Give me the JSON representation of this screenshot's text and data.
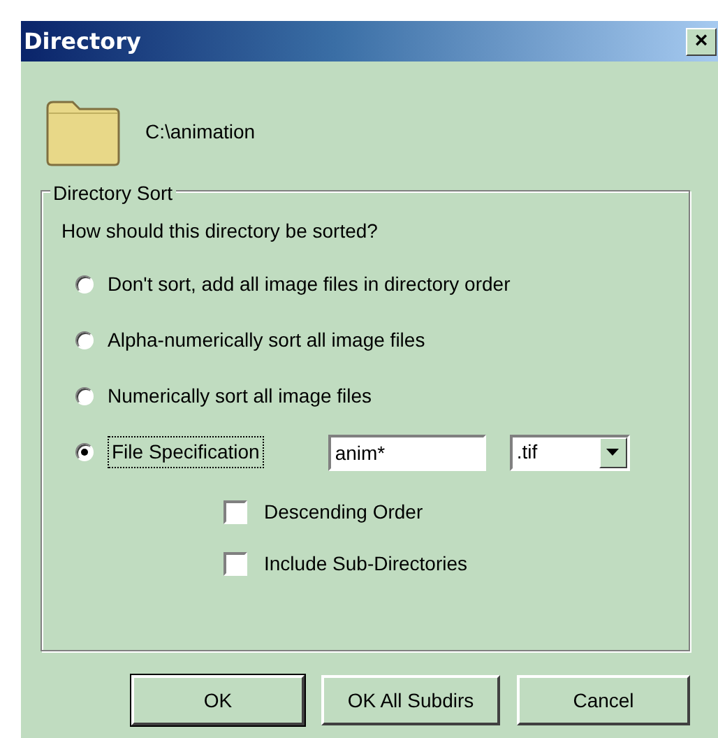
{
  "window": {
    "title": "Directory",
    "close": "×"
  },
  "directory": {
    "path": "C:\\animation"
  },
  "sort_group": {
    "legend": "Directory Sort",
    "question": "How should this directory be sorted?",
    "options": [
      {
        "label": "Don't sort, add all image files in directory order",
        "selected": false
      },
      {
        "label": "Alpha-numerically sort all image files",
        "selected": false
      },
      {
        "label": "Numerically sort all image files",
        "selected": false
      },
      {
        "label": "File Specification",
        "selected": true
      }
    ],
    "pattern": {
      "value": "anim*"
    },
    "extension": {
      "value": ".tif"
    },
    "checkboxes": [
      {
        "label": "Descending Order",
        "checked": false
      },
      {
        "label": "Include Sub-Directories",
        "checked": false
      }
    ]
  },
  "buttons": [
    {
      "label": "OK",
      "default": true
    },
    {
      "label": "OK All Subdirs",
      "default": false
    },
    {
      "label": "Cancel",
      "default": false
    }
  ]
}
